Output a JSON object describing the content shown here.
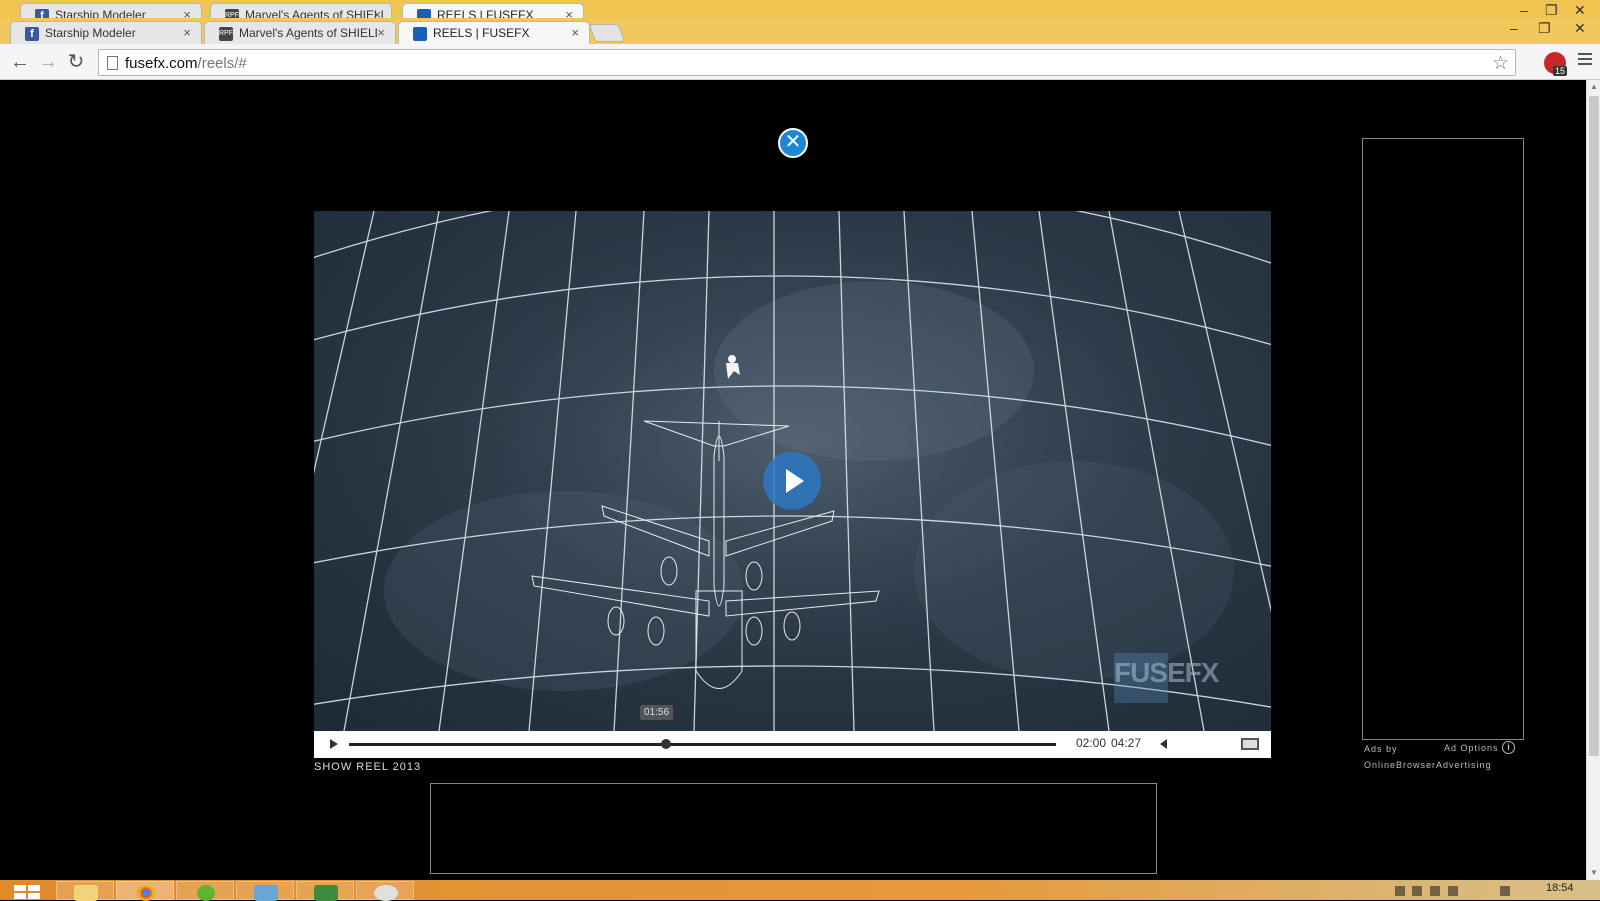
{
  "browser": {
    "ghost_tabs": [
      "Starship Modeler",
      "Marvel's Agents of SHIELD",
      "REELS | FUSEFX"
    ],
    "tabs": [
      {
        "label": "Starship Modeler",
        "icon": "facebook-icon",
        "active": false
      },
      {
        "label": "Marvel's Agents of SHIELD",
        "icon": "rpf-icon",
        "active": false
      },
      {
        "label": "REELS | FUSEFX",
        "icon": "fusefx-icon",
        "active": true
      }
    ],
    "url_host": "fusefx.com",
    "url_path": "/reels/#",
    "extension_badge": "15",
    "window_minimize": "–",
    "window_restore": "❐",
    "window_close": "✕",
    "tab_close": "×",
    "favicon_fb": "f",
    "favicon_rpf": "RPF",
    "star": "☆",
    "back": "←",
    "forward": "→",
    "reload": "↻",
    "scroll_up": "▲",
    "scroll_down": "▼"
  },
  "modal": {
    "close_glyph": "✕"
  },
  "video": {
    "watermark": "FUSEFX",
    "hover_time": "01:56",
    "current_time": "02:00",
    "total_time": "04:27",
    "progress": 0.449,
    "caption": "SHOW REEL 2013"
  },
  "ads": {
    "ads_by": "Ads by",
    "provider": "OnlineBrowserAdvertising",
    "options": "Ad Options",
    "info_glyph": "i"
  },
  "taskbar": {
    "clock": "18:54",
    "apps": [
      "file-explorer-icon",
      "chrome-icon",
      "utorrent-icon",
      "photos-icon",
      "excel-icon",
      "paint-icon"
    ]
  },
  "colors": {
    "accent_blue": "#1c86d8",
    "tabbar_yellow": "#f2c75c",
    "taskbar_orange": "#e08a2a"
  }
}
